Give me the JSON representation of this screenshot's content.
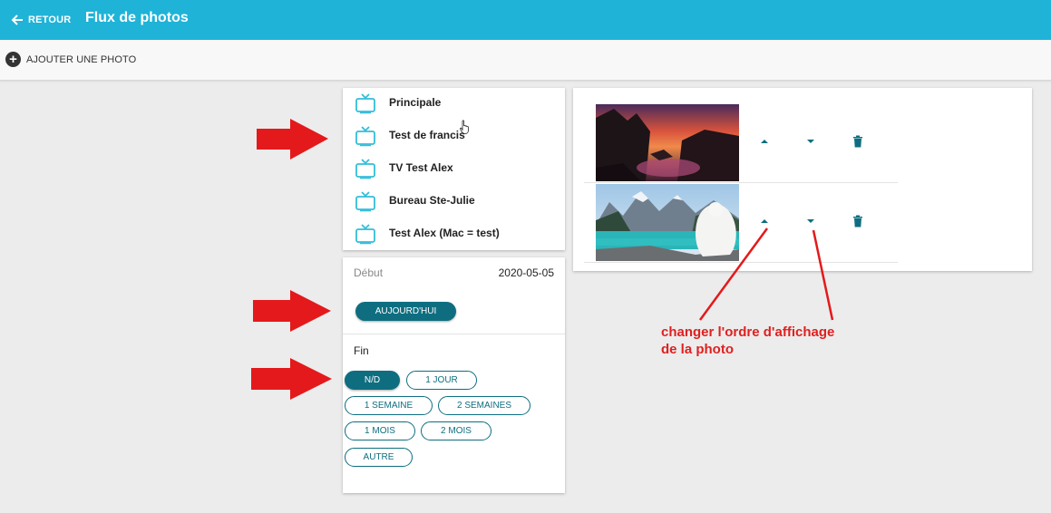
{
  "header": {
    "back_label": "RETOUR",
    "title": "Flux de photos"
  },
  "toolbar": {
    "add_photo_label": "AJOUTER UNE PHOTO"
  },
  "screens": [
    {
      "label": "Principale"
    },
    {
      "label": "Test de francis"
    },
    {
      "label": "TV Test Alex"
    },
    {
      "label": "Bureau Ste-Julie"
    },
    {
      "label": "Test Alex (Mac = test)"
    }
  ],
  "schedule": {
    "start_label": "Début",
    "start_value": "2020-05-05",
    "today_button": "AUJOURD'HUI",
    "end_label": "Fin",
    "end_options": [
      "N/D",
      "1 JOUR",
      "1 SEMAINE",
      "2 SEMAINES",
      "1 MOIS",
      "2 MOIS",
      "AUTRE"
    ],
    "selected_end": "N/D"
  },
  "photos": [
    {
      "description": "sunset-lake"
    },
    {
      "description": "lake-dog"
    }
  ],
  "annotation": {
    "line1": "changer l'ordre d'affichage",
    "line2": "de la photo"
  },
  "colors": {
    "header": "#1fb3d8",
    "accent": "#0e6e80",
    "tv_icon": "#33bdd9",
    "annotation": "#e02020"
  },
  "icons": {
    "back": "arrow-left-icon",
    "add": "plus-circle-icon",
    "screen": "tv-icon",
    "up": "caret-up-icon",
    "down": "caret-down-icon",
    "delete": "trash-icon"
  }
}
